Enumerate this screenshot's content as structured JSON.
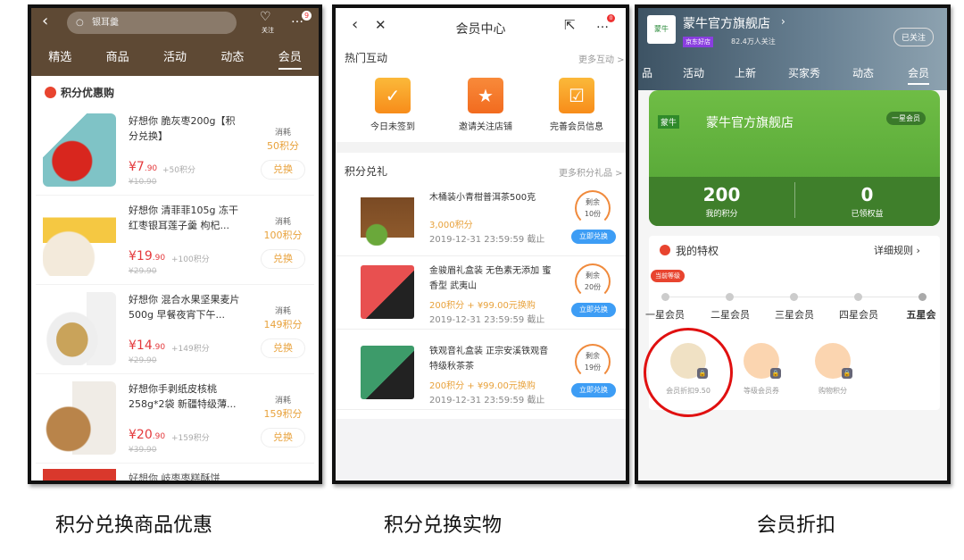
{
  "panel1": {
    "search": "银耳羹",
    "follow": "关注",
    "badge": "9",
    "tabs": [
      "精选",
      "商品",
      "活动",
      "动态",
      "会员"
    ],
    "section": "积分优惠购",
    "cost_label": "消耗",
    "exchange": "兑换",
    "items": [
      {
        "name": "好想你 脆灰枣200g【积分兑换】",
        "price": "¥7",
        "price_dec": ".90",
        "plus": "+50积分",
        "orig": "¥10.90",
        "cost": "50积分"
      },
      {
        "name": "好想你 清菲菲105g 冻干红枣银耳莲子羹 枸杞...",
        "price": "¥19",
        "price_dec": ".90",
        "plus": "+100积分",
        "orig": "¥29.90",
        "cost": "100积分"
      },
      {
        "name": "好想你 混合水果坚果麦片500g 早餐夜宵下午...",
        "price": "¥14",
        "price_dec": ".90",
        "plus": "+149积分",
        "orig": "¥29.90",
        "cost": "149积分"
      },
      {
        "name": "好想你手剥纸皮核桃258g*2袋 新疆特级薄...",
        "price": "¥20",
        "price_dec": ".90",
        "plus": "+159积分",
        "orig": "¥39.90",
        "cost": "159积分"
      }
    ],
    "partial_item": "好想你 岐枣枣糕酥饼"
  },
  "panel2": {
    "title": "会员中心",
    "badge": "0",
    "hot": "热门互动",
    "hot_more": "更多互动 >",
    "actions": [
      "今日未签到",
      "邀请关注店铺",
      "完善会员信息"
    ],
    "gifts": "积分兑礼",
    "gifts_more": "更多积分礼品 >",
    "remain": "剩余",
    "redeem": "立即兑换",
    "items": [
      {
        "name": "木桶装小青柑普洱茶500克",
        "points": "3,000积分",
        "date": "2019-12-31 23:59:59 截止",
        "left": "10份"
      },
      {
        "name": "金骏眉礼盒装 无色素无添加 蜜香型 武夷山",
        "points": "200积分 + ¥99.00元换购",
        "date": "2019-12-31 23:59:59 截止",
        "left": "20份"
      },
      {
        "name": "铁观音礼盒装 正宗安溪铁观音 特级秋茶茶",
        "points": "200积分 + ¥99.00元换购",
        "date": "2019-12-31 23:59:59 截止",
        "left": "19份"
      }
    ]
  },
  "panel3": {
    "store": "蒙牛官方旗舰店",
    "store_arrow": "›",
    "tag": "京东好店",
    "followers": "82.4万人关注",
    "followed": "已关注",
    "logo": "蒙牛",
    "tabs": [
      "品",
      "活动",
      "上新",
      "买家秀",
      "动态",
      "会员"
    ],
    "level_badge": "一星会员",
    "points": "200",
    "points_label": "我的积分",
    "benefits": "0",
    "benefits_label": "已领权益",
    "privileges": "我的特权",
    "rules": "详细规则 ›",
    "current": "当前等级",
    "levels": [
      "一星会员",
      "二星会员",
      "三星会员",
      "四星会员",
      "五星会"
    ],
    "perks": [
      "会员折扣9.50",
      "等级会员券",
      "购物积分"
    ]
  },
  "captions": [
    "积分兑换商品优惠",
    "积分兑换实物",
    "会员折扣"
  ]
}
